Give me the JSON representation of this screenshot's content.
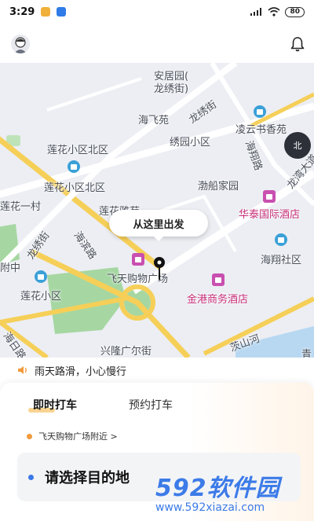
{
  "status_bar": {
    "time": "3:29",
    "battery": "80"
  },
  "notice": {
    "text": "雨天路滑，小心慢行"
  },
  "map": {
    "labels": {
      "anjuyuan": "安居园(",
      "longxiujie_paren": "龙绣街)",
      "haifeiyuan": "海飞苑",
      "longxiujie1": "龙绣街",
      "lingyun": "凌云书香苑",
      "xiuyuan": "绣园小区",
      "lianhua_north": "莲花小区北区",
      "haixianglu": "海翔路",
      "longwan": "龙湾大道",
      "lianhua_north2": "莲花小区北区",
      "bochuan": "渤船家园",
      "lianhua_yicun": "莲花一村",
      "huatai": "华泰国际酒店",
      "lianhua_yuan": "莲花雅苑",
      "haixiang_shequ": "海翔社区",
      "longxiujie2": "龙绣街",
      "haibinlu": "海滨路",
      "zhong": "附中",
      "feitian": "飞天购物广场",
      "jingang": "金港商务酒店",
      "lianhua_xiaoqu": "莲花小区",
      "haiyang": "海日路",
      "xinglong": "兴隆广尔街",
      "bangshan": "茨山河",
      "qing": "青"
    },
    "bubble": "从这里出发",
    "compass": "北"
  },
  "tabs": [
    "即时打车",
    "预约打车"
  ],
  "location": {
    "text": "飞天购物广场附近 >"
  },
  "destination": {
    "placeholder": "请选择目的地"
  },
  "watermark": {
    "main": "592软件园",
    "url": "www.592xiazai.com"
  },
  "colors": {
    "accent": "#f29a3c",
    "blue": "#3b78e7",
    "poi_pink": "#c94fb0"
  }
}
